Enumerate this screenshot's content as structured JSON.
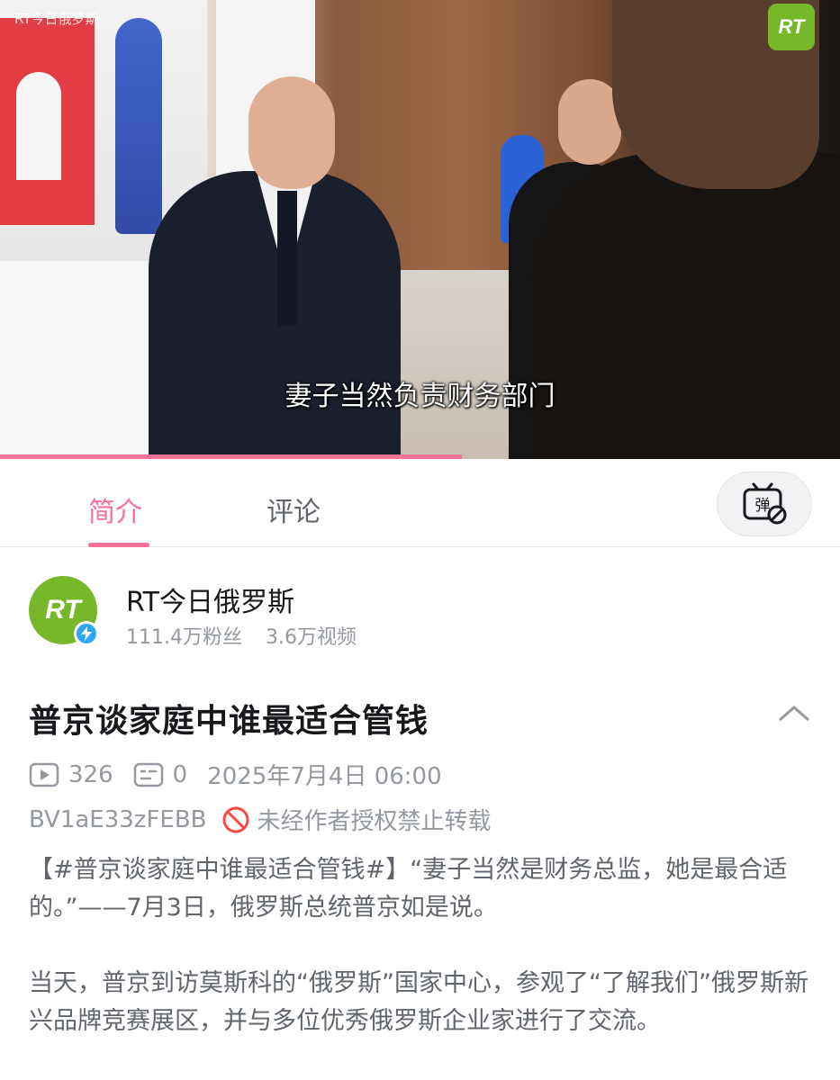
{
  "video": {
    "watermark": "RT今日俄罗斯",
    "logo_text": "RT",
    "subtitle": "妻子当然负责财务部门",
    "progress": 0.55
  },
  "tabs": {
    "intro": "简介",
    "comments": "评论",
    "danmaku_icon": "danmaku-toggle-icon"
  },
  "uploader": {
    "avatar_text": "RT",
    "name": "RT今日俄罗斯",
    "followers": "111.4万粉丝",
    "videos": "3.6万视频"
  },
  "video_info": {
    "title": "普京谈家庭中谁最适合管钱",
    "views": "326",
    "danmaku_count": "0",
    "publish_time": "2025年7月4日 06:00",
    "bvid": "BV1aE33zFEBB",
    "copyright_notice": "未经作者授权禁止转载"
  },
  "description": {
    "paragraph1": "【#普京谈家庭中谁最适合管钱#】“妻子当然是财务总监，她是最合适的。”——7月3日，俄罗斯总统普京如是说。",
    "paragraph2": "当天，普京到访莫斯科的“俄罗斯”国家中心，参观了“了解我们”俄罗斯新兴品牌竞赛展区，并与多位优秀俄罗斯企业家进行了交流。"
  },
  "colors": {
    "accent": "#fb7299",
    "rt_green": "#76b82a",
    "muted": "#9499a0"
  }
}
